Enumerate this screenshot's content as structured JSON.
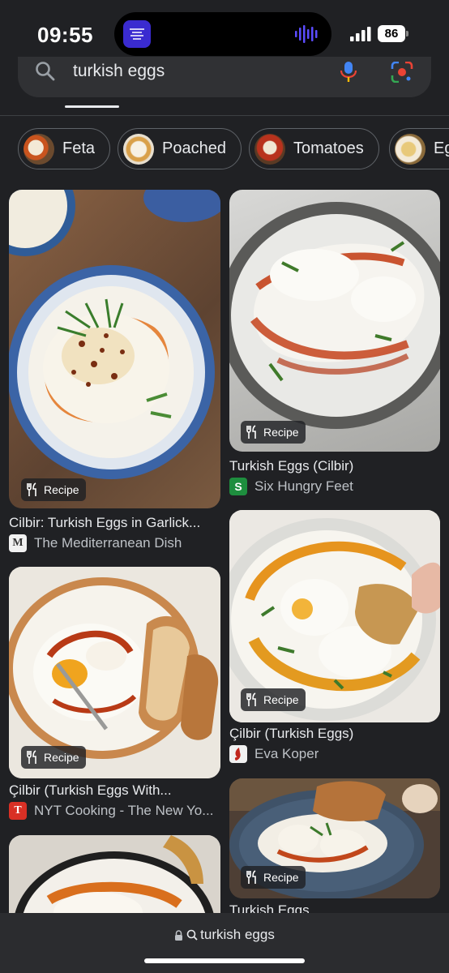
{
  "status": {
    "time": "09:55",
    "battery": "86"
  },
  "search": {
    "query": "turkish eggs"
  },
  "chips": [
    {
      "label": "Feta"
    },
    {
      "label": "Poached"
    },
    {
      "label": "Tomatoes"
    },
    {
      "label": "Eg"
    }
  ],
  "results": [
    {
      "title": "Cilbir: Turkish Eggs in Garlick...",
      "source": "The Mediterranean Dish",
      "source_icon": "M",
      "badge": "Recipe"
    },
    {
      "title": "Turkish Eggs (Cilbir)",
      "source": "Six Hungry Feet",
      "source_icon": "S",
      "badge": "Recipe"
    },
    {
      "title": "Çilbir (Turkish Eggs With...",
      "source": "NYT Cooking - The New Yo...",
      "source_icon": "T",
      "badge": "Recipe"
    },
    {
      "title": "Çilbir (Turkish Eggs)",
      "source": "Eva Koper",
      "source_icon": "",
      "badge": "Recipe"
    },
    {
      "title": "",
      "source": "",
      "source_icon": "",
      "badge": ""
    },
    {
      "title": "Turkish Eggs",
      "source": "",
      "source_icon": "",
      "badge": "Recipe"
    }
  ],
  "bottom": {
    "url_text": "turkish eggs"
  },
  "colors": {
    "background": "#202124",
    "chip_border": "#5f6368",
    "nyt_red": "#d93025",
    "six_green": "#1e8e3e"
  }
}
